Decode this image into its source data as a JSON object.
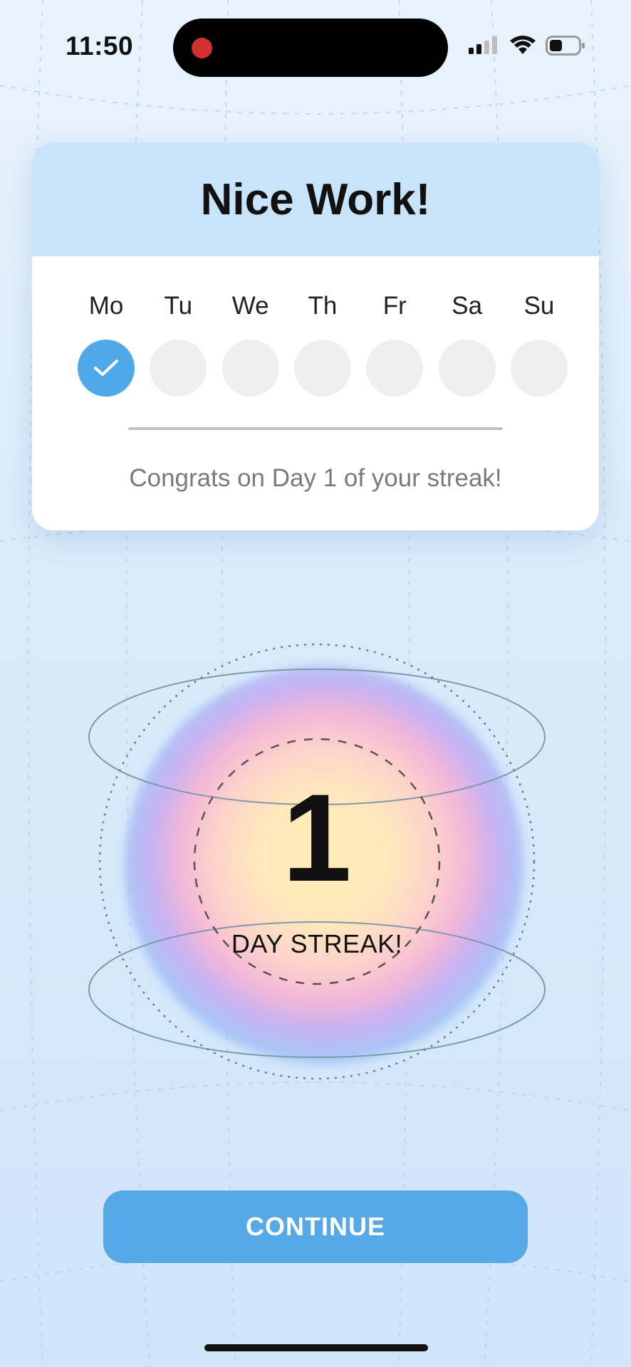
{
  "status_bar": {
    "time": "11:50",
    "recording_color": "#d32f2f"
  },
  "card": {
    "title": "Nice Work!",
    "days": [
      {
        "label": "Mo",
        "completed": true
      },
      {
        "label": "Tu",
        "completed": false
      },
      {
        "label": "We",
        "completed": false
      },
      {
        "label": "Th",
        "completed": false
      },
      {
        "label": "Fr",
        "completed": false
      },
      {
        "label": "Sa",
        "completed": false
      },
      {
        "label": "Su",
        "completed": false
      }
    ],
    "message": "Congrats on Day 1 of your streak!"
  },
  "streak": {
    "count": "1",
    "label": "DAY STREAK!"
  },
  "continue_button": {
    "label": "CONTINUE"
  },
  "colors": {
    "accent": "#54a9e6",
    "header_bg": "#c8e4fa",
    "completed_day": "#4fa9e8",
    "empty_day": "#efefef"
  },
  "icons": {
    "signal": "cellular-signal-icon",
    "wifi": "wifi-icon",
    "battery": "battery-icon",
    "check": "checkmark-icon"
  }
}
